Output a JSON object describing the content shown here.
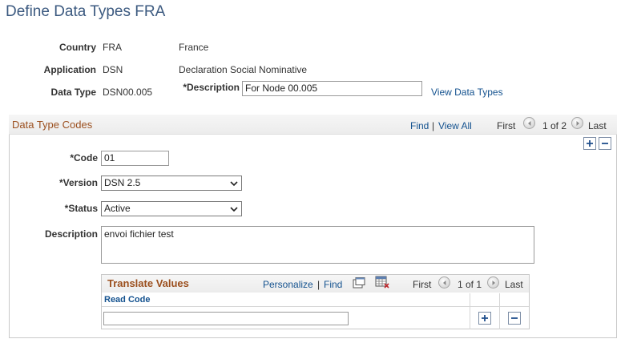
{
  "page": {
    "title": "Define Data Types FRA"
  },
  "header": {
    "country": {
      "label": "Country",
      "code": "FRA",
      "desc": "France"
    },
    "application": {
      "label": "Application",
      "code": "DSN",
      "desc": "Declaration Social Nominative"
    },
    "data_type": {
      "label": "Data Type",
      "code": "DSN00.005"
    },
    "description": {
      "label": "*Description",
      "value": "For Node 00.005"
    },
    "view_link": "View Data Types"
  },
  "codes_group": {
    "title": "Data Type Codes",
    "find": "Find",
    "sep": "|",
    "view_all": "View All",
    "first": "First",
    "count": "1 of 2",
    "last": "Last",
    "code": {
      "label": "*Code",
      "value": "01"
    },
    "version": {
      "label": "*Version",
      "value": "DSN 2.5"
    },
    "status": {
      "label": "*Status",
      "value": "Active"
    },
    "description": {
      "label": "Description",
      "value": "envoi fichier test"
    }
  },
  "translate_grid": {
    "title": "Translate Values",
    "personalize": "Personalize",
    "sep": "|",
    "find": "Find",
    "first": "First",
    "count": "1 of 1",
    "last": "Last",
    "columns": [
      "Read Code"
    ],
    "rows": [
      {
        "read_code": ""
      }
    ]
  },
  "icons": {
    "prev": "prev-arrow-icon",
    "next": "next-arrow-icon",
    "add": "plus-icon",
    "remove": "minus-icon",
    "chevron": "chevron-down-icon",
    "view_grid": "new-window-icon",
    "download": "download-excel-icon"
  },
  "colors": {
    "title": "#3c5a80",
    "link": "#14528f",
    "group_title": "#9b4f1e"
  }
}
